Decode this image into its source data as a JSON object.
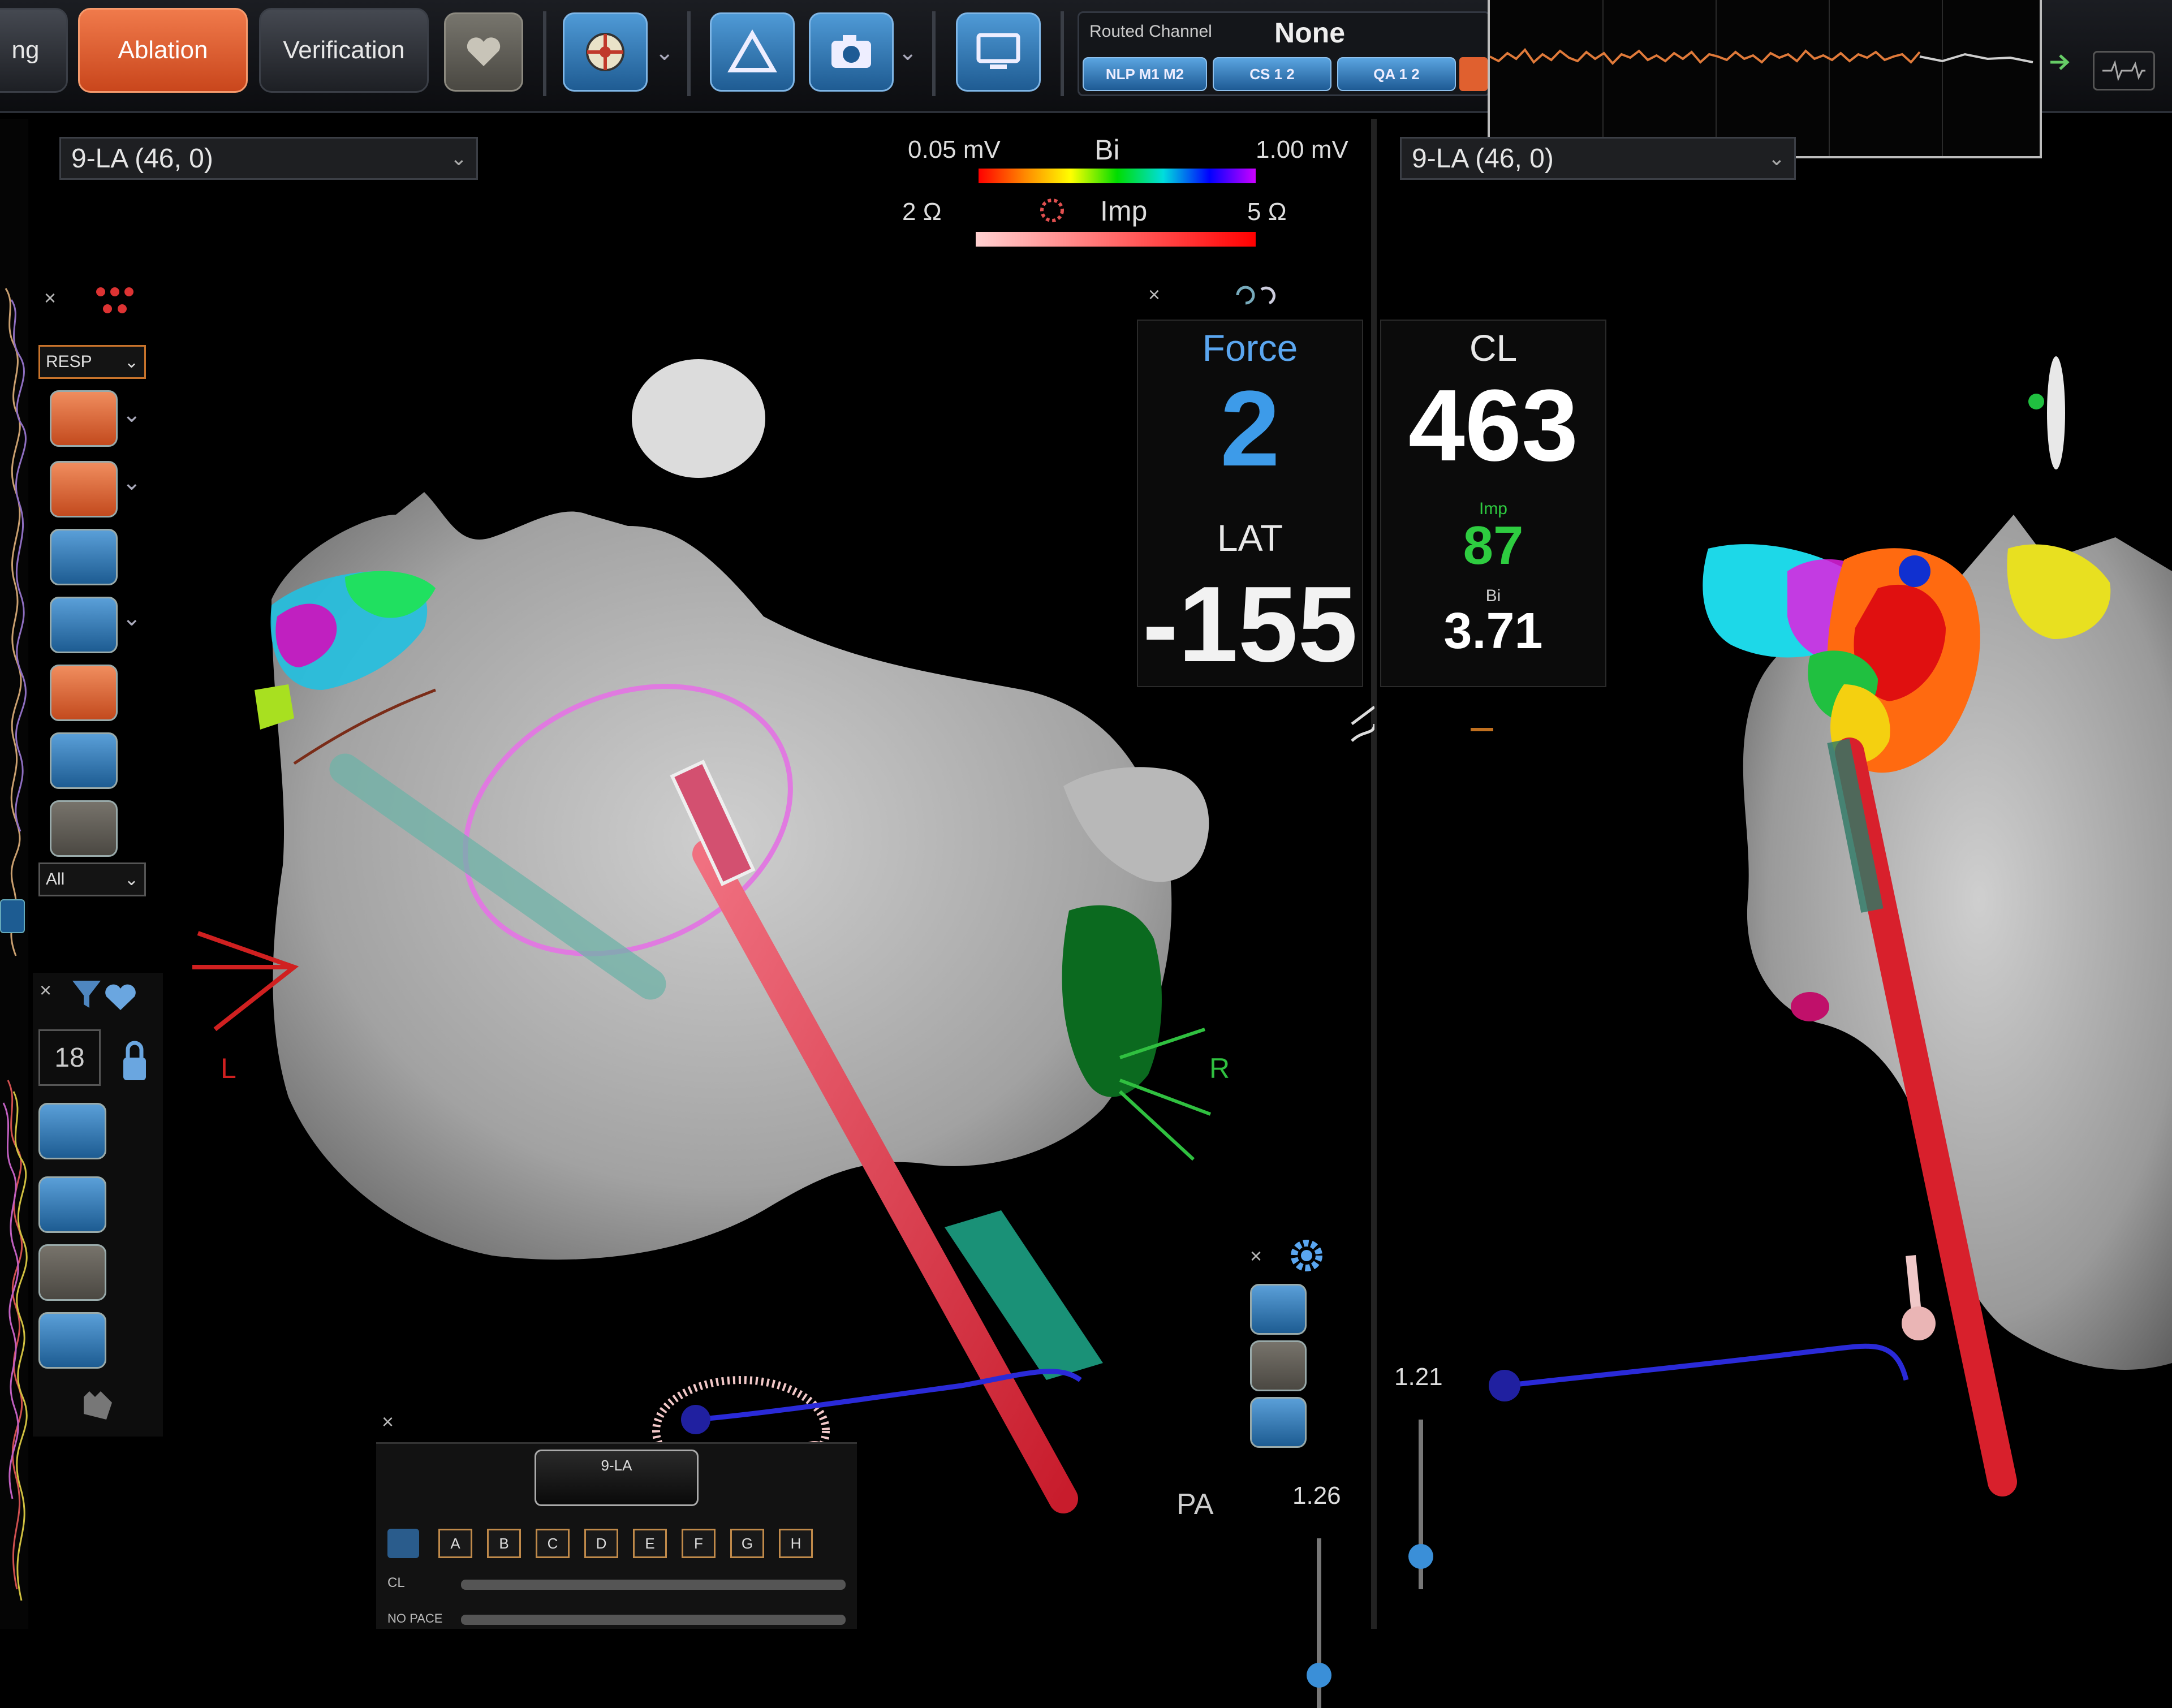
{
  "toolbar": {
    "tabs": [
      "ng",
      "Ablation",
      "Verification"
    ],
    "active_tab": "Ablation",
    "routed_channel_label": "Routed Channel",
    "routed_channel_value": "None",
    "channel_buttons": [
      "NLP M1 M2",
      "CS 1 2",
      "QA 1 2"
    ],
    "ecg_color": "#e07a3a",
    "ecg_trace": [
      0,
      4,
      -3,
      2,
      -6,
      5,
      -2,
      3,
      -5,
      1,
      4,
      -4,
      2,
      -3,
      6,
      -2,
      1,
      -5,
      3,
      -1,
      4,
      -3,
      2,
      -4,
      5,
      -2,
      0,
      3,
      -4,
      2,
      -1,
      5,
      -3,
      1,
      -2,
      4,
      -5,
      2,
      -1,
      3,
      -3,
      4,
      -2,
      1,
      -4,
      3,
      0,
      -2,
      5,
      -4
    ]
  },
  "left_view": {
    "map_selector": "9-LA (46, 0)",
    "legend_bi": {
      "min": "0.05 mV",
      "label": "Bi",
      "max": "1.00 mV"
    },
    "legend_imp": {
      "min": "2 Ω",
      "label": "Imp",
      "max": "5 Ω"
    },
    "force": {
      "label": "Force",
      "value": "2"
    },
    "lat": {
      "label": "LAT",
      "value": "-155"
    },
    "cl": {
      "label": "CL",
      "value": "463"
    },
    "imp": {
      "label": "Imp",
      "value": "87"
    },
    "bi": {
      "label": "Bi",
      "value": "3.71"
    },
    "label_l": "L",
    "label_r": "R",
    "label_pa": "PA",
    "resp_select": "RESP",
    "all_select": "All",
    "counter_value": "18",
    "slider1_value": "1.26",
    "map_tab_label": "9-LA",
    "letter_buttons": [
      "A",
      "B",
      "C",
      "D",
      "E",
      "F",
      "G",
      "H"
    ],
    "row_labels": [
      "CL",
      "NO PACE"
    ]
  },
  "right_view": {
    "map_selector": "9-LA (46, 0)",
    "slider2_value": "1.21"
  },
  "colors": {
    "accent_orange": "#e0602f",
    "force_blue": "#3d9be9",
    "imp_green": "#2ecc40",
    "catheter_red": "#e0303a",
    "anatomy_gray": "#a9a9a9"
  }
}
